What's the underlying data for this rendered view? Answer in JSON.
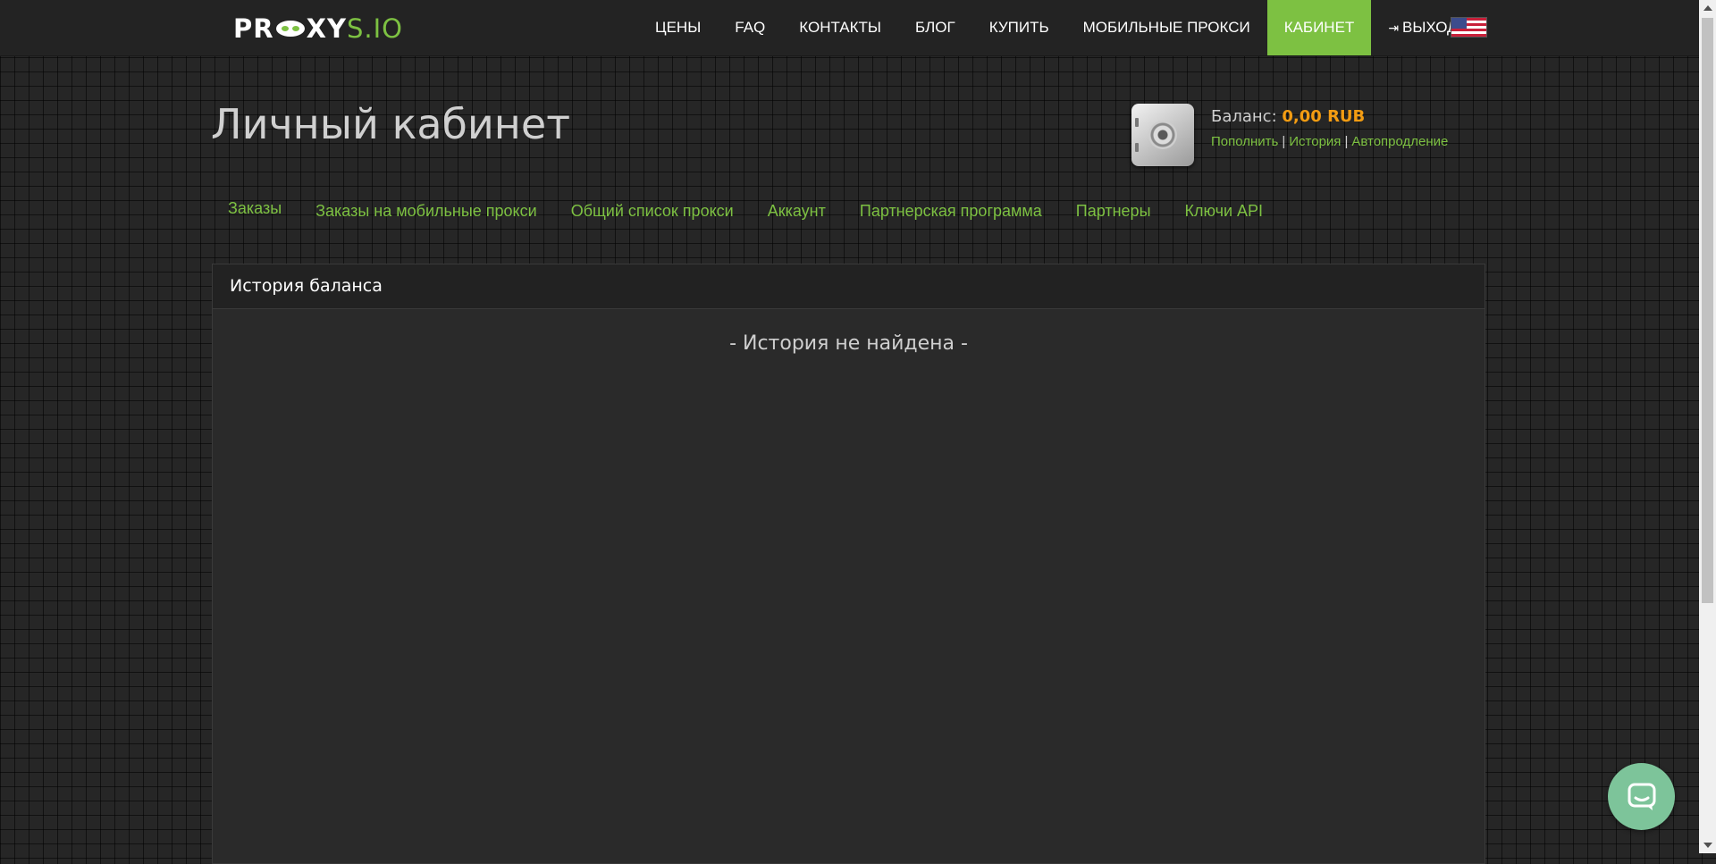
{
  "logo": {
    "left": "PR",
    "right": "XY",
    "suffix": "S.IO"
  },
  "nav": {
    "items": [
      {
        "label": "ЦЕНЫ"
      },
      {
        "label": "FAQ"
      },
      {
        "label": "КОНТАКТЫ"
      },
      {
        "label": "БЛОГ"
      },
      {
        "label": "КУПИТЬ"
      },
      {
        "label": "МОБИЛЬНЫЕ ПРОКСИ"
      },
      {
        "label": "КАБИНЕТ",
        "active": true
      }
    ],
    "logout_label": "ВЫХОД",
    "language_flag": "us-flag-icon"
  },
  "page": {
    "title": "Личный кабинет"
  },
  "balance": {
    "label": "Баланс:",
    "value": "0,00 RUB",
    "links": {
      "topup": "Пополнить",
      "history": "История",
      "autorenew": "Автопродление"
    },
    "separator": "|"
  },
  "subnav": {
    "items": [
      {
        "label": "Заказы"
      },
      {
        "label": "Заказы на мобильные прокси"
      },
      {
        "label": "Общий список прокси"
      },
      {
        "label": "Аккаунт"
      },
      {
        "label": "Партнерская программа"
      },
      {
        "label": "Партнеры"
      },
      {
        "label": "Ключи API"
      }
    ]
  },
  "panel": {
    "title": "История баланса",
    "empty_text": "- История не найдена -"
  },
  "colors": {
    "accent": "#7dc142",
    "balance": "#f39c12",
    "chat": "#7dc49a"
  }
}
